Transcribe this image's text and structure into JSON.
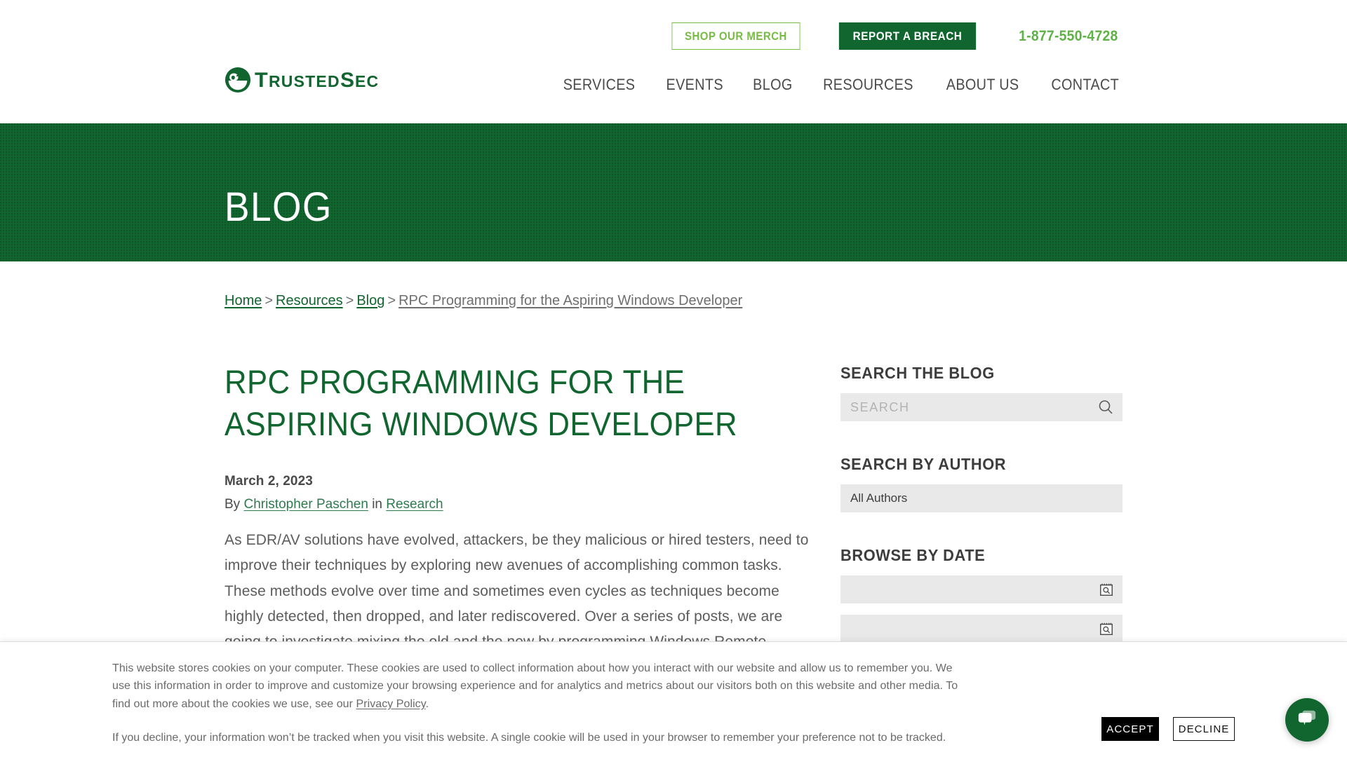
{
  "header": {
    "logo": {
      "name": "TrustedSec",
      "text_parts": [
        "T",
        "RUSTED",
        "S",
        "EC"
      ],
      "color": "#11652f"
    },
    "utility": {
      "merch_label": "SHOP OUR MERCH",
      "breach_label": "REPORT A BREACH",
      "phone": "1-877-550-4728",
      "merch_color": "#76bc43",
      "breach_bg": "#11652f",
      "phone_color": "#5fb246"
    },
    "nav": [
      {
        "label": "SERVICES"
      },
      {
        "label": "EVENTS"
      },
      {
        "label": "BLOG"
      },
      {
        "label": "RESOURCES"
      },
      {
        "label": "ABOUT US"
      },
      {
        "label": "CONTACT"
      }
    ]
  },
  "hero": {
    "title": "BLOG",
    "bg_color": "#11652f"
  },
  "breadcrumb": {
    "items": [
      {
        "label": "Home",
        "current": false
      },
      {
        "label": "Resources",
        "current": false
      },
      {
        "label": "Blog",
        "current": false
      },
      {
        "label": "RPC Programming for the Aspiring Windows Developer",
        "current": true
      }
    ],
    "separator": ">"
  },
  "article": {
    "title": "RPC Programming for the Aspiring Windows Developer",
    "date": "March 2, 2023",
    "by_prefix": "By",
    "author": "Christopher Paschen",
    "in_word": "in",
    "category": "Research",
    "body": "As EDR/AV solutions have evolved, attackers, be they malicious or hired testers, need to improve their techniques by exploring new avenues of accomplishing common tasks. These methods evolve over time and sometimes even cycles as techniques become highly detected, then dropped, and later rediscovered. Over a series of posts, we are going to investigate mixing the old and the new by programming Windows Remote Procedure Call (RPC) calls into a Beacon Object File (BOF)."
  },
  "sidebar": {
    "search_blog": {
      "heading": "SEARCH THE BLOG",
      "placeholder": "SEARCH",
      "value": ""
    },
    "search_author": {
      "heading": "SEARCH BY AUTHOR",
      "selected": "All Authors"
    },
    "browse_date": {
      "heading": "BROWSE BY DATE",
      "from_value": "",
      "to_value": ""
    }
  },
  "cookie": {
    "paragraph1_a": "This website stores cookies on your computer. These cookies are used to collect information about how you interact with our website and allow us to remember you. We use this information in order to improve and customize your browsing experience and for analytics and metrics about our visitors both on this website and other media. To find out more about the cookies we use, see our ",
    "privacy_link": "Privacy Policy",
    "paragraph1_b": ".",
    "paragraph2": "If you decline, your information won’t be tracked when you visit this website. A single cookie will be used in your browser to remember your preference not to be tracked.",
    "accept_label": "ACCEPT",
    "decline_label": "DECLINE"
  },
  "chat": {
    "icon": "chat-bubbles-icon",
    "bg_color": "#11652f"
  }
}
